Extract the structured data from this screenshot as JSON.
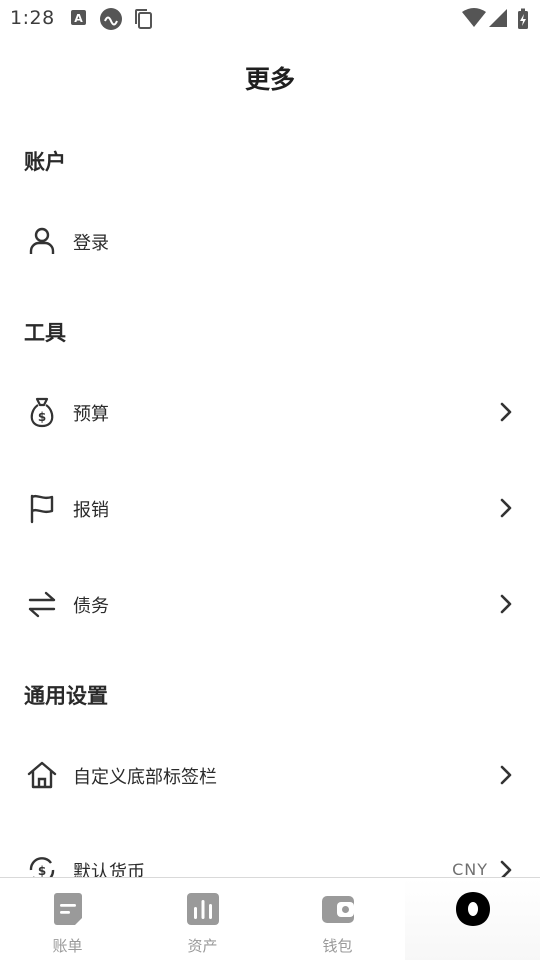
{
  "status_bar": {
    "time": "1:28"
  },
  "header": {
    "title": "更多"
  },
  "sections": {
    "account": {
      "heading": "账户",
      "login_label": "登录"
    },
    "tools": {
      "heading": "工具",
      "budget_label": "预算",
      "reimburse_label": "报销",
      "debt_label": "债务"
    },
    "general": {
      "heading": "通用设置",
      "custom_tabbar_label": "自定义底部标签栏",
      "default_currency_label": "默认货币",
      "default_currency_value": "CNY"
    }
  },
  "bottom_nav": {
    "items": [
      {
        "label": "账单",
        "icon": "bill-icon"
      },
      {
        "label": "资产",
        "icon": "chart-icon"
      },
      {
        "label": "钱包",
        "icon": "wallet-icon"
      },
      {
        "label": "",
        "icon": "more-blob-icon"
      }
    ]
  },
  "colors": {
    "text_primary": "#1f1f1f",
    "nav_icon_inactive": "#9a9a9a",
    "nav_icon_active": "#000000",
    "divider": "#d9d9d9"
  }
}
